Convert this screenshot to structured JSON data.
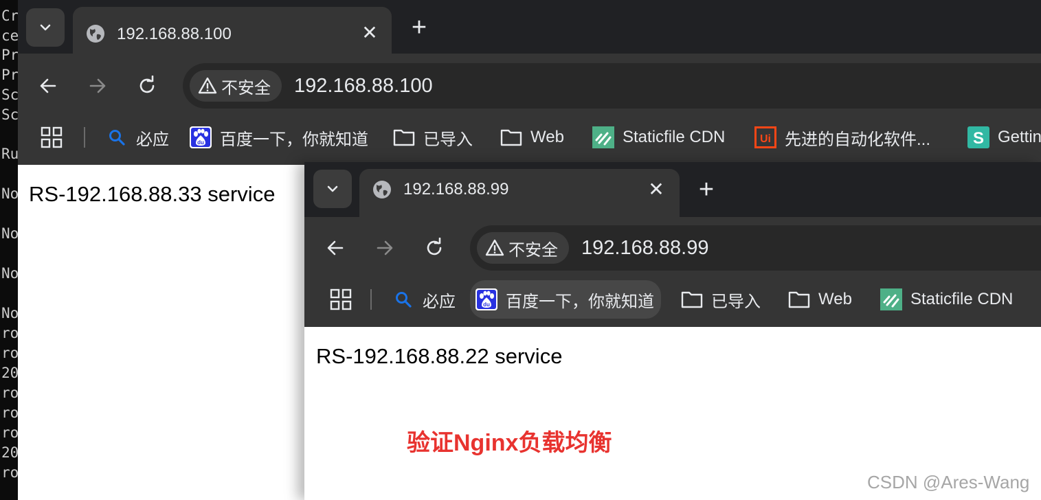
{
  "terminal": {
    "lines": [
      "Cr",
      "ce",
      "Pr",
      "Pr",
      "Sc",
      "Sc",
      "Ru",
      "No",
      "No",
      "No",
      "No",
      "ro",
      "ro",
      "20",
      "ro",
      "ro",
      "ro",
      "20",
      "ro"
    ]
  },
  "window_back": {
    "tab_title": "192.168.88.100",
    "security_label": "不安全",
    "url": "192.168.88.100",
    "bookmarks": [
      {
        "label": "必应",
        "icon": "search-icon"
      },
      {
        "label": "百度一下，你就知道",
        "icon": "baidu-icon"
      },
      {
        "label": "已导入",
        "icon": "folder-icon"
      },
      {
        "label": "Web",
        "icon": "folder-icon"
      },
      {
        "label": "Staticfile CDN",
        "icon": "staticfile-icon"
      },
      {
        "label": "先进的自动化软件...",
        "icon": "uipath-icon"
      },
      {
        "label": "Gettin",
        "icon": "s-icon"
      }
    ],
    "page_text": "RS-192.168.88.33 service"
  },
  "window_front": {
    "tab_title": "192.168.88.99",
    "security_label": "不安全",
    "url": "192.168.88.99",
    "bookmarks": [
      {
        "label": "必应",
        "icon": "search-icon"
      },
      {
        "label": "百度一下，你就知道",
        "icon": "baidu-icon"
      },
      {
        "label": "已导入",
        "icon": "folder-icon"
      },
      {
        "label": "Web",
        "icon": "folder-icon"
      },
      {
        "label": "Staticfile CDN",
        "icon": "staticfile-icon"
      }
    ],
    "page_text": "RS-192.168.88.22 service"
  },
  "annotation": "验证Nginx负载均衡",
  "watermark": "CSDN @Ares-Wang",
  "colors": {
    "tabstrip": "#202124",
    "toolbar": "#353535",
    "omnibox": "#282828",
    "annotation": "#e8332f"
  }
}
